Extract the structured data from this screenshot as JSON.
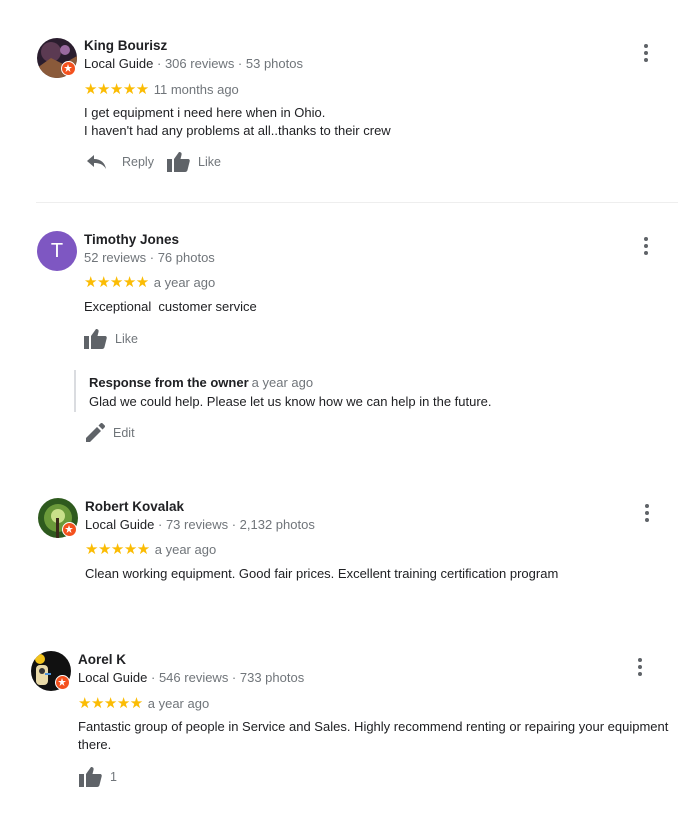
{
  "reviews": [
    {
      "name": "King Bourisz",
      "guide_label": "Local Guide",
      "stats": "· 306 reviews · 53 photos",
      "stars": "★★★★★",
      "time": "11 months ago",
      "text_lines": [
        "I get equipment i need here when in Ohio.",
        "I haven't had any problems at all..thanks to their crew"
      ],
      "reply_label": "Reply",
      "like_label": "Like"
    },
    {
      "name": "Timothy Jones",
      "avatar_letter": "T",
      "stats": "52 reviews · 76 photos",
      "stars": "★★★★★",
      "time": "a year ago",
      "text": "Exceptional  customer service",
      "like_label": "Like",
      "owner_response": {
        "title": "Response from the owner",
        "time": "a year ago",
        "text": "Glad we could help. Please let us know how we can help in the future."
      },
      "edit_label": "Edit"
    },
    {
      "name": "Robert Kovalak",
      "guide_label": "Local Guide",
      "stats": "· 73 reviews · 2,132 photos",
      "stars": "★★★★★",
      "time": "a year ago",
      "text": "Clean working equipment. Good fair prices. Excellent training certification program"
    },
    {
      "name": "Aorel K",
      "guide_label": "Local Guide",
      "stats": "· 546 reviews · 733 photos",
      "stars": "★★★★★",
      "time": "a year ago",
      "text_lines": [
        "Fantastic group of people in Service and Sales. Highly recommend renting or repairing your equipment",
        "there."
      ],
      "like_count": "1"
    }
  ],
  "colors": {
    "star": "#fbbc04",
    "guide_badge": "#f4511e",
    "avatar_t": "#7e57c2",
    "muted": "#70757a"
  },
  "icons": [
    "reply-icon",
    "thumbs-up-icon",
    "pencil-icon",
    "more-vert-icon",
    "local-guide-badge-icon"
  ]
}
